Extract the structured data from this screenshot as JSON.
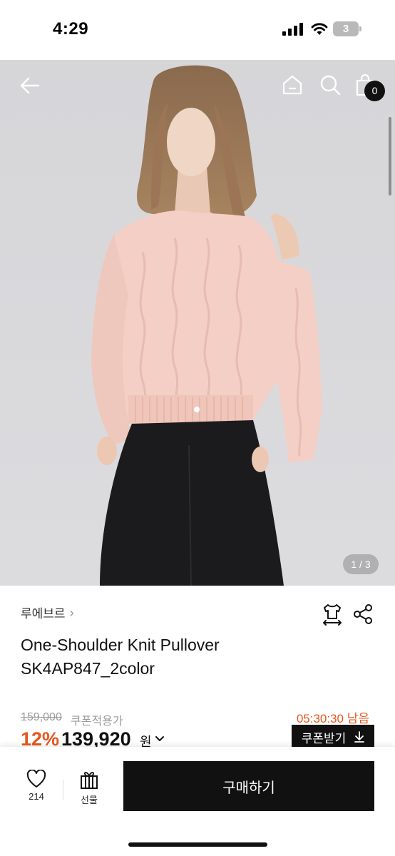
{
  "status_bar": {
    "time": "4:29",
    "battery": "3",
    "icons": [
      "signal-icon",
      "wifi-icon",
      "battery-icon"
    ]
  },
  "header": {
    "icons": [
      "back-arrow-icon",
      "home-icon",
      "search-icon",
      "shopping-bag-icon"
    ],
    "cart_count": "0"
  },
  "gallery": {
    "image_description_alt": "",
    "counter": "1 / 3"
  },
  "product": {
    "brand": "루에브르",
    "brand_chevron": "›",
    "title_line1": "One-Shoulder Knit Pullover",
    "title_line2": "SK4AP847_2color",
    "original_price": "159,000",
    "coupon_applied_label": "쿠폰적용가",
    "countdown": "05:30:30 남음",
    "discount": "12%",
    "price": "139,920",
    "currency": "원",
    "coupon_button": "쿠폰받기",
    "action_icons": [
      "size-guide-icon",
      "share-icon"
    ]
  },
  "bottom_bar": {
    "wish_count": "214",
    "gift_label": "선물",
    "buy_label": "구매하기"
  },
  "colors": {
    "accent_orange": "#e8561e",
    "black": "#111111",
    "sweater_pink": "#f3cfc6",
    "pants_black": "#1b1b1d"
  }
}
